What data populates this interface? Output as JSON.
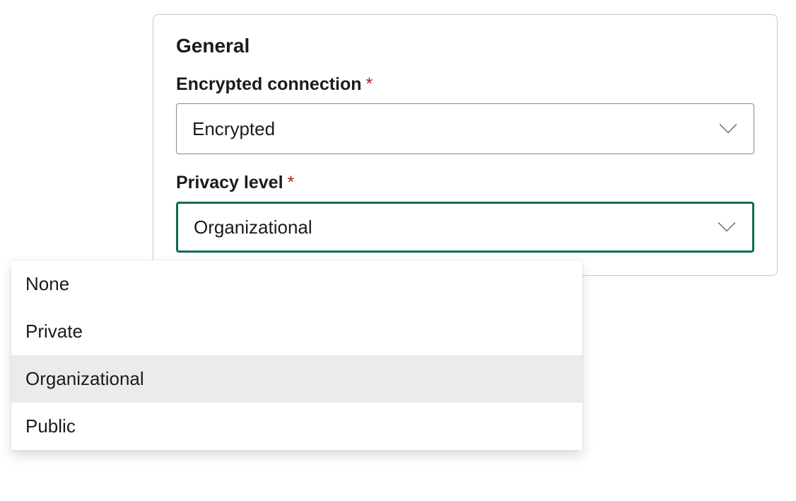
{
  "section": {
    "title": "General"
  },
  "fields": {
    "encrypted_connection": {
      "label": "Encrypted connection",
      "required_marker": "*",
      "value": "Encrypted"
    },
    "privacy_level": {
      "label": "Privacy level",
      "required_marker": "*",
      "value": "Organizational",
      "options": [
        "None",
        "Private",
        "Organizational",
        "Public"
      ],
      "selected_option_index": 2
    }
  }
}
